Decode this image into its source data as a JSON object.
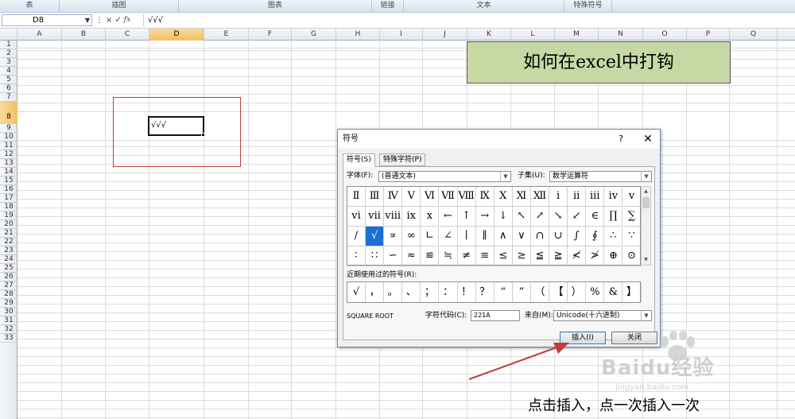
{
  "ribbon": {
    "groups": [
      "表",
      "插图",
      "图表",
      "链接",
      "文本",
      "特殊符号"
    ]
  },
  "formula_bar": {
    "name_box": "D8",
    "cancel_glyph": "×",
    "enter_glyph": "✓",
    "fx_label": "fx",
    "formula_value": "√√√"
  },
  "columns": [
    "A",
    "B",
    "C",
    "D",
    "E",
    "F",
    "G",
    "H",
    "I",
    "J",
    "K",
    "L",
    "M",
    "N",
    "O",
    "P",
    "Q"
  ],
  "rows": [
    "1",
    "2",
    "3",
    "4",
    "5",
    "6",
    "7",
    "8",
    "9",
    "10",
    "11",
    "12",
    "13",
    "14",
    "15",
    "16",
    "17",
    "18",
    "19",
    "20",
    "21",
    "22",
    "23",
    "24",
    "25",
    "26",
    "27",
    "28",
    "29",
    "30",
    "31",
    "32",
    "33"
  ],
  "selected_column": "D",
  "selected_row": "8",
  "active_cell": {
    "ref": "D8",
    "value": "√√√"
  },
  "title_banner": "如何在excel中打钩",
  "dialog": {
    "title": "符号",
    "help_glyph": "?",
    "close_glyph": "✕",
    "tabs": [
      "符号(S)",
      "特殊字符(P)"
    ],
    "font_label": "字体(F):",
    "font_value": "(普通文本)",
    "subset_label": "子集(U):",
    "subset_value": "数学运算符",
    "symbols": [
      [
        "Ⅱ",
        "Ⅲ",
        "Ⅳ",
        "Ⅴ",
        "Ⅵ",
        "Ⅶ",
        "Ⅷ",
        "Ⅸ",
        "Ⅹ",
        "Ⅺ",
        "Ⅻ",
        "ⅰ",
        "ⅱ",
        "ⅲ",
        "ⅳ",
        "ⅴ"
      ],
      [
        "ⅵ",
        "ⅶ",
        "ⅷ",
        "ⅸ",
        "ⅹ",
        "←",
        "↑",
        "→",
        "↓",
        "↖",
        "↗",
        "↘",
        "↙",
        "∈",
        "∏",
        "∑"
      ],
      [
        "∕",
        "√",
        "∝",
        "∞",
        "∟",
        "∠",
        "∣",
        "∥",
        "∧",
        "∨",
        "∩",
        "∪",
        "∫",
        "∮",
        "∴",
        "∵"
      ],
      [
        "∶",
        "∷",
        "∽",
        "≈",
        "≌",
        "≒",
        "≠",
        "≡",
        "≤",
        "≥",
        "≦",
        "≧",
        "≮",
        "≯",
        "⊕",
        "⊙"
      ]
    ],
    "selected_symbol": "√",
    "recent_label": "近期使用过的符号(R):",
    "recent_symbols": [
      "√",
      "，",
      "。",
      "、",
      "；",
      "：",
      "！",
      "？",
      "“",
      "”",
      "（",
      "【",
      "）",
      "%",
      "&",
      "】"
    ],
    "char_name": "SQUARE ROOT",
    "char_code_label": "字符代码(C):",
    "char_code_value": "221A",
    "from_label": "来自(M):",
    "from_value": "Unicode(十六进制)",
    "insert_button": "插入(I)",
    "close_button": "关闭"
  },
  "caption": "点击插入，点一次插入一次",
  "watermark": {
    "brand": "Baidu经验",
    "url": "jingyan.baidu.com"
  },
  "colors": {
    "banner_fill": "#c6d9a5",
    "selected_symbol_fill": "#1b6fd6",
    "annotation_red": "#c43b3b",
    "header_highlight": "#f1c15f"
  }
}
